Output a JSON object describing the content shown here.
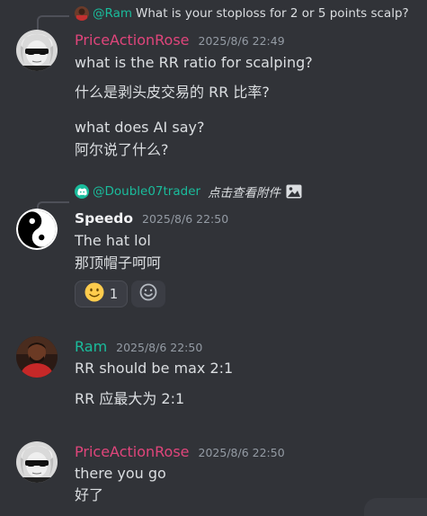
{
  "messages": [
    {
      "reply": {
        "username": "@Ram",
        "text": "What is your stoploss for 2 or 5 points scalp?"
      },
      "username": "PriceActionRose",
      "timestamp": "2025/8/6 22:49",
      "lines": [
        "what is the RR ratio for scalping?",
        "什么是剥头皮交易的 RR 比率?",
        "what does AI say?",
        "阿尔说了什么?"
      ],
      "colors": {
        "username": "#e0457b"
      }
    },
    {
      "reply": {
        "username": "@Double07trader",
        "text": "点击查看附件",
        "icon": "discord-icon",
        "attachment_icon": "image-icon"
      },
      "username": "Speedo",
      "timestamp": "2025/8/6 22:50",
      "lines": [
        "The hat lol",
        "那顶帽子呵呵"
      ],
      "reactions": [
        {
          "emoji": "slightly-smiling-face-icon",
          "count": "1"
        },
        {
          "emoji": "add-reaction-icon",
          "count": ""
        }
      ],
      "colors": {
        "username": "#f2f3f5"
      }
    },
    {
      "username": "Ram",
      "timestamp": "2025/8/6 22:50",
      "lines": [
        "RR should be max 2:1",
        "RR 应最大为 2:1"
      ],
      "colors": {
        "username": "#1abc9c"
      }
    },
    {
      "username": "PriceActionRose",
      "timestamp": "2025/8/6 22:50",
      "lines": [
        "there you go",
        "好了"
      ],
      "colors": {
        "username": "#e0457b"
      }
    }
  ],
  "theme": {
    "background": "#313338",
    "text": "#dbdee1",
    "muted": "#949ba4",
    "accent_teal": "#1abc9c"
  }
}
